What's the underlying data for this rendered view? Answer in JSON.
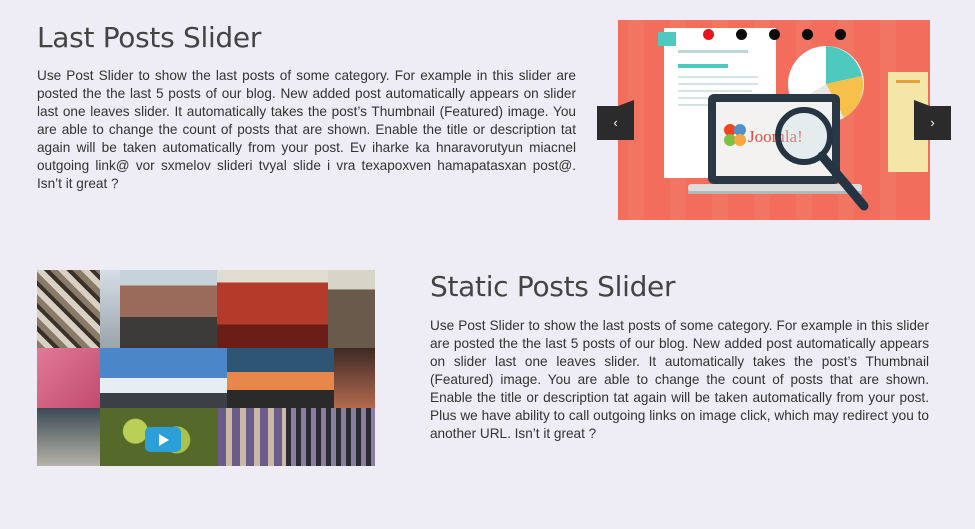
{
  "section1": {
    "title": "Last Posts Slider",
    "description": "Use Post Slider to show the last posts of some category. For example in this slider are posted the the last 5 posts of our blog. New added post automatically appears on slider last one leaves slider. It automatically takes the post’s Thumbnail (Featured) image. You are able  to change the count of posts that are shown. Enable the title or description tat again will be taken automatically from your post. Ev iharke ka hnaravorutyun miacnel outgoing link@ vor sxmelov slideri tvyal slide i vra texapoxven hamapatasxan post@. Isn’t it great ?",
    "slider": {
      "slide_count": 5,
      "active_slide": 1,
      "logo_text": "Joomla!",
      "prev_icon": "‹",
      "next_icon": "›",
      "background_color": "#f26d5b",
      "active_dot_color": "#e8141b"
    }
  },
  "section2": {
    "title": "Static Posts Slider",
    "description": "Use Post Slider to show the last posts of some category. For example in this slider are posted the the last 5 posts of our blog. New added post automatically appears on slider last one leaves slider. It automatically takes the post’s Thumbnail (Featured) image. You are able to change the count of posts that are shown. Enable the title or description tat again will be taken automatically from your post. Plus we have ability to call outgoing links on image click, which may redirect you to another URL. Isn’t it great ?",
    "play_icon": "play-icon",
    "play_color": "#2a9fd8"
  },
  "colors": {
    "page_background": "#eeecf4",
    "heading": "#444444"
  }
}
